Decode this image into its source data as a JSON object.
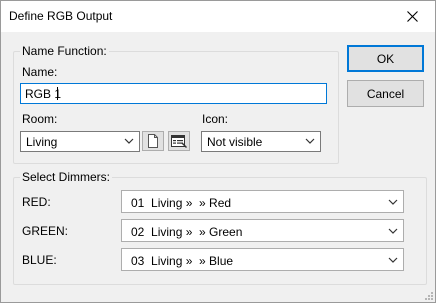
{
  "window": {
    "title": "Define RGB Output"
  },
  "name_function": {
    "legend": "Name Function:",
    "name_label": "Name:",
    "name_value": "RGB 1",
    "room_label": "Room:",
    "room_value": "Living",
    "icon_label": "Icon:",
    "icon_value": "Not visible"
  },
  "dimmers": {
    "legend": "Select Dimmers:",
    "rows": [
      {
        "label": "RED:",
        "value": "01  Living »  » Red"
      },
      {
        "label": "GREEN:",
        "value": "02  Living »  » Green"
      },
      {
        "label": "BLUE:",
        "value": "03  Living »  » Blue"
      }
    ]
  },
  "buttons": {
    "ok": "OK",
    "cancel": "Cancel"
  },
  "icons": {
    "close": "close-icon",
    "new_room": "new-document-icon",
    "room_properties": "room-properties-icon",
    "dropdown": "chevron-down-icon",
    "resize": "resize-grip-icon"
  },
  "colors": {
    "focus_border": "#0078d7",
    "dialog_bg": "#f0f0f0"
  }
}
